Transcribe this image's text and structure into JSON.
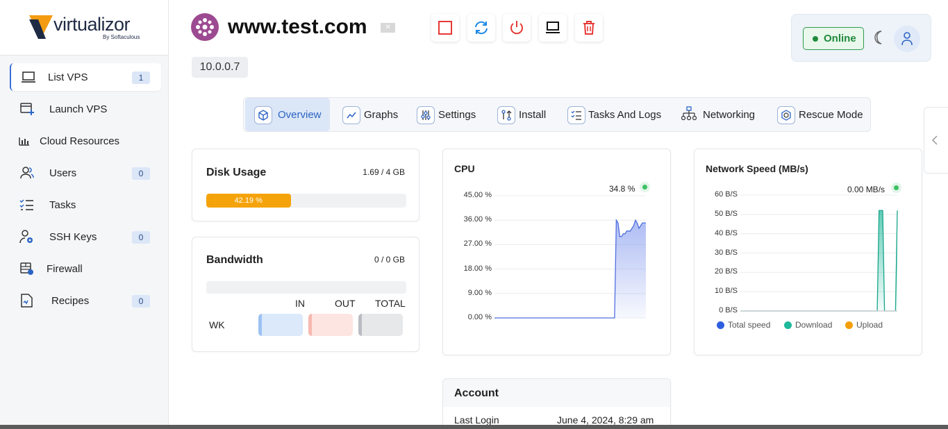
{
  "brand": {
    "name": "virtualizor",
    "tagline": "By Softaculous"
  },
  "sidebar": {
    "items": [
      {
        "label": "List VPS",
        "badge": "1",
        "icon": "laptop-icon"
      },
      {
        "label": "Launch VPS",
        "badge": "",
        "icon": "launch-icon"
      },
      {
        "label": "Cloud Resources",
        "badge": "",
        "icon": "bar-chart-icon"
      },
      {
        "label": "Users",
        "badge": "0",
        "icon": "users-icon"
      },
      {
        "label": "Tasks",
        "badge": "",
        "icon": "checklist-icon"
      },
      {
        "label": "SSH Keys",
        "badge": "0",
        "icon": "user-key-icon"
      },
      {
        "label": "Firewall",
        "badge": "",
        "icon": "firewall-icon"
      },
      {
        "label": "Recipes",
        "badge": "0",
        "icon": "recipe-icon"
      }
    ]
  },
  "header": {
    "hostname": "www.test.com",
    "ip": "10.0.0.7",
    "flag": "✕",
    "status": "Online",
    "actions": [
      "stop-icon",
      "restart-icon",
      "power-icon",
      "console-icon",
      "delete-icon"
    ]
  },
  "tabs": [
    {
      "label": "Overview",
      "icon": "cube-icon"
    },
    {
      "label": "Graphs",
      "icon": "line-graph-icon"
    },
    {
      "label": "Settings",
      "icon": "sliders-icon"
    },
    {
      "label": "Install",
      "icon": "install-icon"
    },
    {
      "label": "Tasks And Logs",
      "icon": "tasks-icon"
    },
    {
      "label": "Networking",
      "icon": "network-icon"
    },
    {
      "label": "Rescue Mode",
      "icon": "rescue-icon"
    }
  ],
  "disk": {
    "title": "Disk Usage",
    "value": "1.69 / 4 GB",
    "percent_label": "42.19 %",
    "percent": 42.19
  },
  "bandwidth": {
    "title": "Bandwidth",
    "value": "0 / 0 GB",
    "percent": 0,
    "headers": [
      "IN",
      "OUT",
      "TOTAL"
    ],
    "row_label": "WK"
  },
  "cpu": {
    "title": "CPU",
    "current": "34.8 %",
    "yticks": [
      "45.00 %",
      "36.00 %",
      "27.00 %",
      "18.00 %",
      "9.00 %",
      "0.00 %"
    ]
  },
  "network": {
    "title": "Network Speed (MB/s)",
    "current": "0.00 MB/s",
    "yticks": [
      "60 B/S",
      "50 B/S",
      "40 B/S",
      "30 B/S",
      "20 B/S",
      "10 B/S",
      "0 B/S"
    ],
    "legend": [
      {
        "name": "Total speed",
        "color": "#2f5fe0"
      },
      {
        "name": "Download",
        "color": "#1fb89a"
      },
      {
        "name": "Upload",
        "color": "#f59e0b"
      }
    ]
  },
  "account": {
    "title": "Account",
    "last_login_label": "Last Login",
    "last_login_value": "June 4, 2024, 8:29 am"
  },
  "chart_data": [
    {
      "type": "area",
      "title": "CPU",
      "ylim": [
        0,
        45
      ],
      "y_unit": "%",
      "values": [
        0,
        0,
        0,
        0,
        0,
        0,
        0,
        0,
        0,
        0,
        0,
        0,
        0,
        0,
        0,
        0,
        0,
        0,
        0,
        0,
        0,
        0,
        0,
        0,
        0,
        0,
        0,
        0,
        0,
        0,
        0,
        0,
        0,
        0,
        0,
        0,
        0,
        0,
        0,
        0,
        0,
        0,
        0,
        0,
        0,
        0,
        0,
        0,
        0,
        0,
        0,
        0,
        0,
        0,
        0,
        0,
        0,
        0,
        0,
        0,
        0,
        0,
        0,
        0,
        0,
        0,
        0,
        0,
        0,
        0,
        36,
        35,
        30,
        30,
        31,
        31,
        32,
        32,
        32,
        33,
        34,
        36,
        35,
        33,
        34,
        35,
        35,
        35
      ]
    },
    {
      "type": "area",
      "title": "Network Speed (MB/s)",
      "ylim": [
        0,
        60
      ],
      "y_unit": "B/S",
      "series": [
        {
          "name": "Total speed",
          "values": [
            0,
            0,
            0,
            0,
            0,
            0,
            0,
            0,
            0,
            0,
            0,
            0,
            0,
            0,
            0,
            0,
            0,
            0,
            0,
            0,
            0,
            0,
            0,
            0,
            0,
            0,
            0,
            0,
            0,
            0,
            0,
            0,
            0,
            0,
            0,
            0,
            0,
            0,
            0,
            0,
            0,
            0,
            0,
            0,
            0,
            0,
            0,
            0,
            0,
            0,
            0,
            0,
            0,
            0,
            0,
            0,
            0,
            0,
            0,
            0,
            0,
            0,
            0,
            0,
            0,
            0,
            0,
            0,
            0,
            0,
            0,
            0,
            0,
            0,
            0,
            0,
            0,
            0,
            0,
            0,
            0,
            0,
            0,
            0,
            0,
            0,
            0
          ]
        },
        {
          "name": "Download",
          "values": [
            0,
            0,
            0,
            0,
            0,
            0,
            0,
            0,
            0,
            0,
            0,
            0,
            0,
            0,
            0,
            0,
            0,
            0,
            0,
            0,
            0,
            0,
            0,
            0,
            0,
            0,
            0,
            0,
            0,
            0,
            0,
            0,
            0,
            0,
            0,
            0,
            0,
            0,
            0,
            0,
            0,
            0,
            0,
            0,
            0,
            0,
            0,
            0,
            0,
            0,
            0,
            0,
            0,
            0,
            0,
            0,
            0,
            0,
            0,
            0,
            0,
            0,
            0,
            0,
            0,
            0,
            0,
            0,
            0,
            0,
            0,
            0,
            0,
            0,
            0,
            0,
            52,
            52,
            52,
            0,
            0,
            0,
            0,
            0,
            0,
            0,
            52
          ]
        },
        {
          "name": "Upload",
          "values": [
            0,
            0,
            0,
            0,
            0,
            0,
            0,
            0,
            0,
            0,
            0,
            0,
            0,
            0,
            0,
            0,
            0,
            0,
            0,
            0,
            0,
            0,
            0,
            0,
            0,
            0,
            0,
            0,
            0,
            0,
            0,
            0,
            0,
            0,
            0,
            0,
            0,
            0,
            0,
            0,
            0,
            0,
            0,
            0,
            0,
            0,
            0,
            0,
            0,
            0,
            0,
            0,
            0,
            0,
            0,
            0,
            0,
            0,
            0,
            0,
            0,
            0,
            0,
            0,
            0,
            0,
            0,
            0,
            0,
            0,
            0,
            0,
            0,
            0,
            0,
            0,
            0,
            0,
            0,
            0,
            0,
            0,
            0,
            0,
            0,
            0,
            0
          ]
        }
      ]
    }
  ]
}
